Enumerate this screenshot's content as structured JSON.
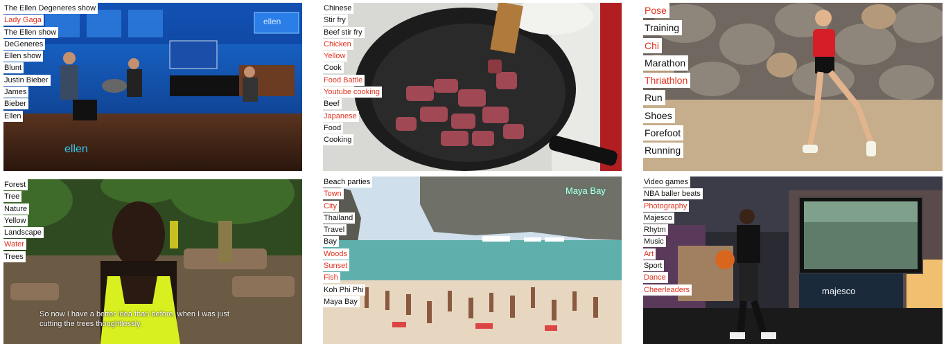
{
  "panels": [
    {
      "id": "ellen",
      "tags": [
        {
          "text": "The Ellen Degeneres show",
          "red": false
        },
        {
          "text": "Lady Gaga",
          "red": true
        },
        {
          "text": "The Ellen show",
          "red": false
        },
        {
          "text": "DeGeneres",
          "red": false
        },
        {
          "text": "Ellen show",
          "red": false
        },
        {
          "text": "Blunt",
          "red": false
        },
        {
          "text": "Justin Bieber",
          "red": false
        },
        {
          "text": "James",
          "red": false
        },
        {
          "text": "Bieber",
          "red": false
        },
        {
          "text": "Ellen",
          "red": false
        }
      ],
      "watermark": "ellen",
      "screen_logo": "ellen"
    },
    {
      "id": "cooking",
      "tags": [
        {
          "text": "Chinese",
          "red": false
        },
        {
          "text": "Stir fry",
          "red": false
        },
        {
          "text": "Beef stir fry",
          "red": false
        },
        {
          "text": "Chicken",
          "red": true
        },
        {
          "text": "Yellow",
          "red": true
        },
        {
          "text": "Cook",
          "red": false
        },
        {
          "text": "Food Battle",
          "red": true
        },
        {
          "text": "Youtube cooking",
          "red": true
        },
        {
          "text": "Beef",
          "red": false
        },
        {
          "text": "Japanese",
          "red": true
        },
        {
          "text": "Food",
          "red": false
        },
        {
          "text": "Cooking",
          "red": false
        }
      ]
    },
    {
      "id": "running",
      "tags": [
        {
          "text": "Pose",
          "red": true
        },
        {
          "text": "Training",
          "red": false
        },
        {
          "text": "Chi",
          "red": true
        },
        {
          "text": "Marathon",
          "red": false
        },
        {
          "text": "Thriathlon",
          "red": true
        },
        {
          "text": "Run",
          "red": false
        },
        {
          "text": "Shoes",
          "red": false
        },
        {
          "text": "Forefoot",
          "red": false
        },
        {
          "text": "Running",
          "red": false
        }
      ]
    },
    {
      "id": "forest",
      "tags": [
        {
          "text": "Forest",
          "red": false
        },
        {
          "text": "Tree",
          "red": false
        },
        {
          "text": "Nature",
          "red": false
        },
        {
          "text": "Yellow",
          "red": false
        },
        {
          "text": "Landscape",
          "red": false
        },
        {
          "text": "Water",
          "red": true
        },
        {
          "text": "Trees",
          "red": false
        }
      ],
      "subtitle": "So now I have a better idea than before, when I was just\ncutting the trees thoughtlessly."
    },
    {
      "id": "beach",
      "tags": [
        {
          "text": "Beach parties",
          "red": false
        },
        {
          "text": "Town",
          "red": true
        },
        {
          "text": "City",
          "red": true
        },
        {
          "text": "Thailand",
          "red": false
        },
        {
          "text": "Travel",
          "red": false
        },
        {
          "text": "Bay",
          "red": false
        },
        {
          "text": "Woods",
          "red": true
        },
        {
          "text": "Sunset",
          "red": true
        },
        {
          "text": "Fish",
          "red": true
        },
        {
          "text": "Koh Phi Phi",
          "red": false
        },
        {
          "text": "Maya Bay",
          "red": false
        }
      ],
      "overlay": "Maya Bay"
    },
    {
      "id": "gaming",
      "tags": [
        {
          "text": "Video games",
          "red": false
        },
        {
          "text": "NBA baller beats",
          "red": false
        },
        {
          "text": "Photography",
          "red": true
        },
        {
          "text": "Majesco",
          "red": false
        },
        {
          "text": "Rhytm",
          "red": false
        },
        {
          "text": "Music",
          "red": false
        },
        {
          "text": "Art",
          "red": true
        },
        {
          "text": "Sport",
          "red": false
        },
        {
          "text": "Dance",
          "red": true
        },
        {
          "text": "Cheerleaders",
          "red": true
        }
      ],
      "logo": "majesco"
    }
  ]
}
